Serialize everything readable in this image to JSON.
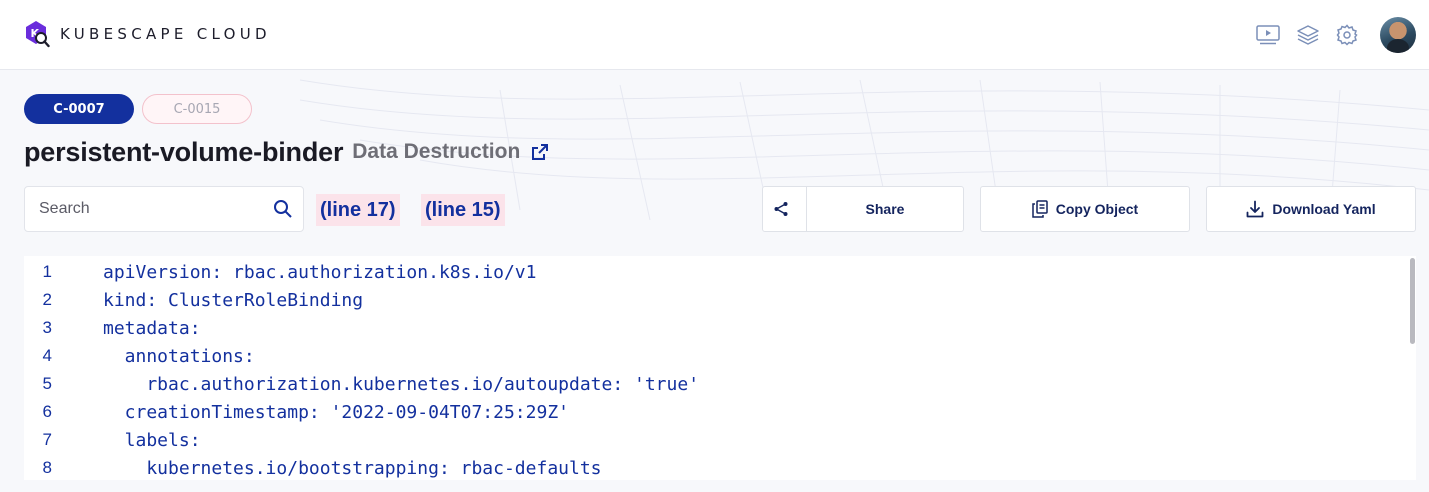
{
  "header": {
    "brand": "KUBESCAPE CLOUD",
    "icons": [
      "monitor-play-icon",
      "layers-icon",
      "settings-gear-icon"
    ],
    "avatar": "user-avatar"
  },
  "controls": {
    "active": "C-0007",
    "inactive": "C-0015"
  },
  "resource": {
    "name": "persistent-volume-binder",
    "category": "Data Destruction"
  },
  "search": {
    "placeholder": "Search",
    "value": ""
  },
  "highlights": [
    "(line 17)",
    "(line 15)"
  ],
  "actions": {
    "share": "Share",
    "copy": "Copy Object",
    "download": "Download Yaml"
  },
  "code": {
    "lines": [
      {
        "n": "1",
        "text": "apiVersion: rbac.authorization.k8s.io/v1"
      },
      {
        "n": "2",
        "text": "kind: ClusterRoleBinding"
      },
      {
        "n": "3",
        "text": "metadata:"
      },
      {
        "n": "4",
        "text": "  annotations:"
      },
      {
        "n": "5",
        "text": "    rbac.authorization.kubernetes.io/autoupdate: 'true'"
      },
      {
        "n": "6",
        "text": "  creationTimestamp: '2022-09-04T07:25:29Z'"
      },
      {
        "n": "7",
        "text": "  labels:"
      },
      {
        "n": "8",
        "text": "    kubernetes.io/bootstrapping: rbac-defaults"
      }
    ]
  },
  "colors": {
    "accent": "#13309e",
    "highlight_bg": "#fbe3ea",
    "logo": "#6a2ddc"
  }
}
